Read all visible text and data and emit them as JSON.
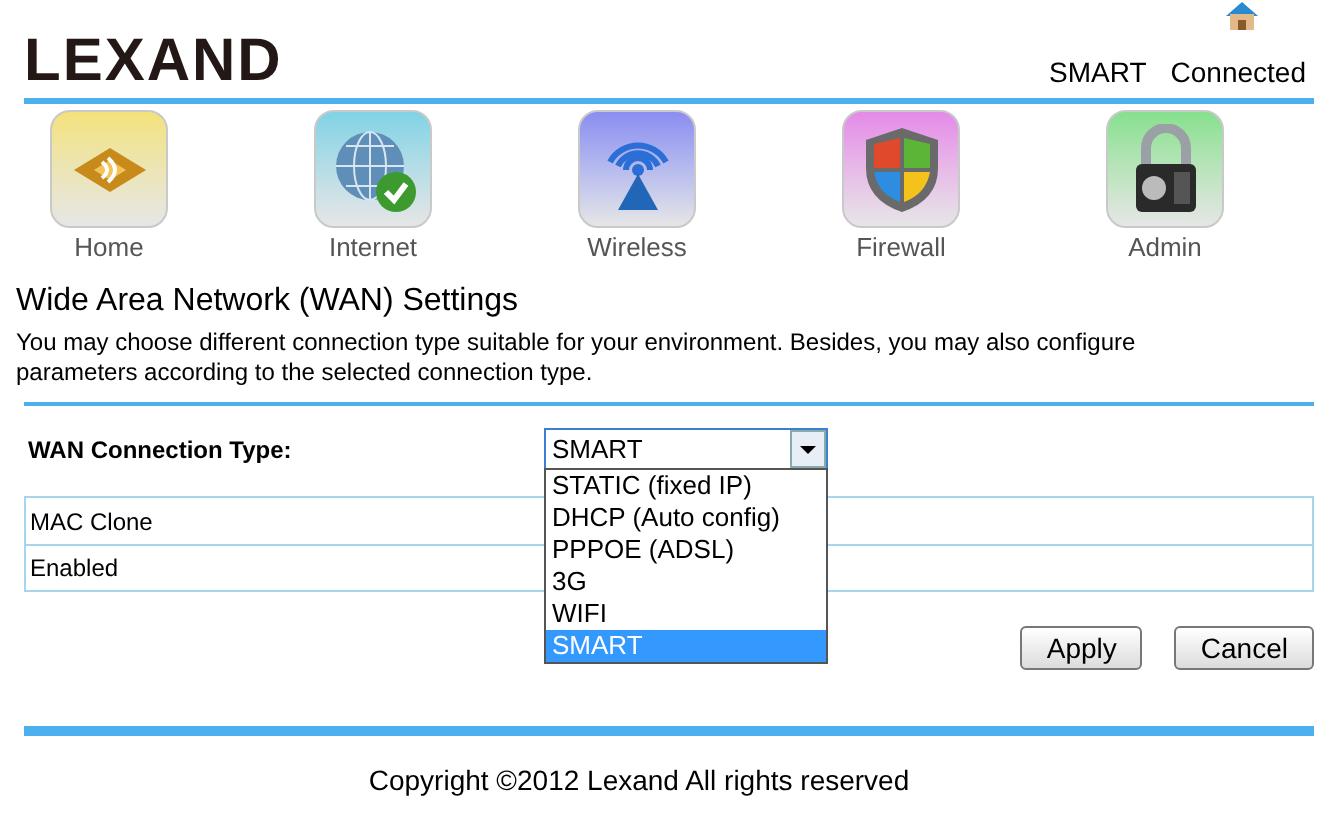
{
  "brand": {
    "logo": "LEXAND"
  },
  "status": {
    "mode": "SMART",
    "connection": "Connected"
  },
  "nav": [
    {
      "label": "Home",
      "kind": "home"
    },
    {
      "label": "Internet",
      "kind": "internet"
    },
    {
      "label": "Wireless",
      "kind": "wireless"
    },
    {
      "label": "Firewall",
      "kind": "firewall"
    },
    {
      "label": "Admin",
      "kind": "admin"
    }
  ],
  "page": {
    "title": "Wide Area Network (WAN) Settings",
    "description": "You may choose different connection type suitable for your environment. Besides, you may also configure parameters according to the selected connection type."
  },
  "form": {
    "connection_type": {
      "label": "WAN Connection Type:",
      "value": "SMART",
      "expanded": true,
      "options": [
        {
          "label": "STATIC (fixed IP)",
          "selected": false
        },
        {
          "label": "DHCP (Auto config)",
          "selected": false
        },
        {
          "label": "PPPOE (ADSL)",
          "selected": false
        },
        {
          "label": "3G",
          "selected": false
        },
        {
          "label": "WIFI",
          "selected": false
        },
        {
          "label": "SMART",
          "selected": true
        }
      ]
    },
    "rows": [
      {
        "label": "MAC Clone"
      },
      {
        "label": "Enabled"
      }
    ]
  },
  "buttons": [
    "Apply",
    "Cancel"
  ],
  "footer": "Copyright ©2012 Lexand All rights reserved"
}
